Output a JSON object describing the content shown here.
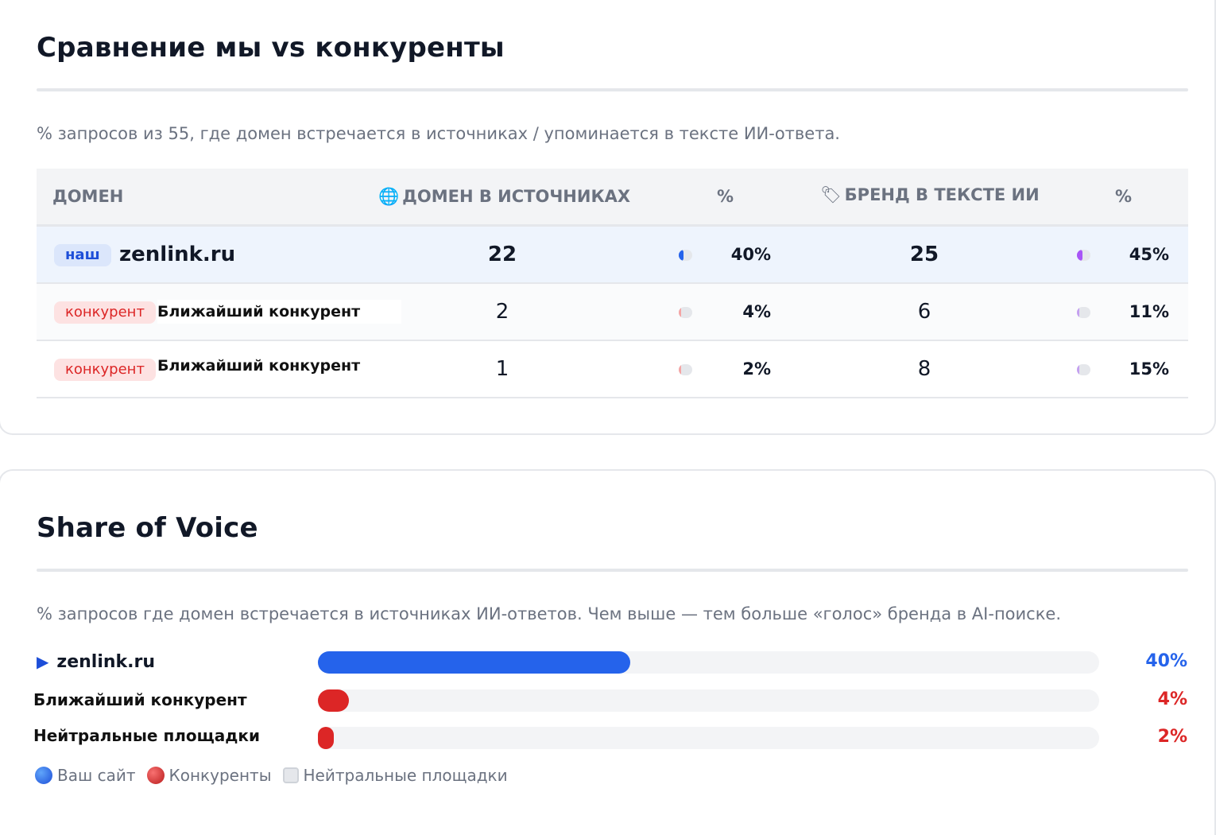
{
  "comparison": {
    "title": "Сравнение мы vs конкуренты",
    "subtitle": "% запросов из 55, где домен встречается в источниках / упоминается в тексте ИИ-ответа.",
    "headers": {
      "domain": "ДОМЕН",
      "sources_icon": "🌐",
      "sources": "ДОМЕН В ИСТОЧНИКАХ",
      "pct1": "%",
      "brand_icon": "🏷",
      "brand": "БРЕНД В ТЕКСТЕ ИИ",
      "pct2": "%"
    },
    "rows": [
      {
        "badge": "наш",
        "domain": "zenlink.ru",
        "sources": "22",
        "sources_pct": "40%",
        "sources_ratio": 0.4,
        "brand": "25",
        "brand_pct": "45%",
        "brand_ratio": 0.45
      },
      {
        "badge": "конкурент",
        "domain": "Ближайший конкурент",
        "sources": "2",
        "sources_pct": "4%",
        "sources_ratio": 0.04,
        "brand": "6",
        "brand_pct": "11%",
        "brand_ratio": 0.11
      },
      {
        "badge": "конкурент",
        "domain": "Ближайший конкурент",
        "sources": "1",
        "sources_pct": "2%",
        "sources_ratio": 0.02,
        "brand": "8",
        "brand_pct": "15%",
        "brand_ratio": 0.15
      }
    ]
  },
  "share_of_voice": {
    "title": "Share of Voice",
    "subtitle": "% запросов где домен встречается в источниках ИИ-ответов. Чем выше — тем больше «голос» бренда в AI-поиске.",
    "rows": [
      {
        "marker": "▶",
        "label": "zenlink.ru",
        "value": 40,
        "pct": "40%",
        "color": "#2563eb"
      },
      {
        "label": "Ближайший конкурент",
        "value": 4,
        "pct": "4%",
        "color": "#dc2626"
      },
      {
        "label": "Нейтральные площадки",
        "value": 2,
        "pct": "2%",
        "color": "#dc2626"
      }
    ],
    "legend": {
      "ours": "Ваш сайт",
      "competitors": "Конкуренты",
      "neutral": "Нейтральные площадки"
    }
  },
  "colors": {
    "ours": "#2563eb",
    "competitor": "#dc2626",
    "brand_accent": "#a855f7",
    "neutral": "#e5e7eb"
  }
}
